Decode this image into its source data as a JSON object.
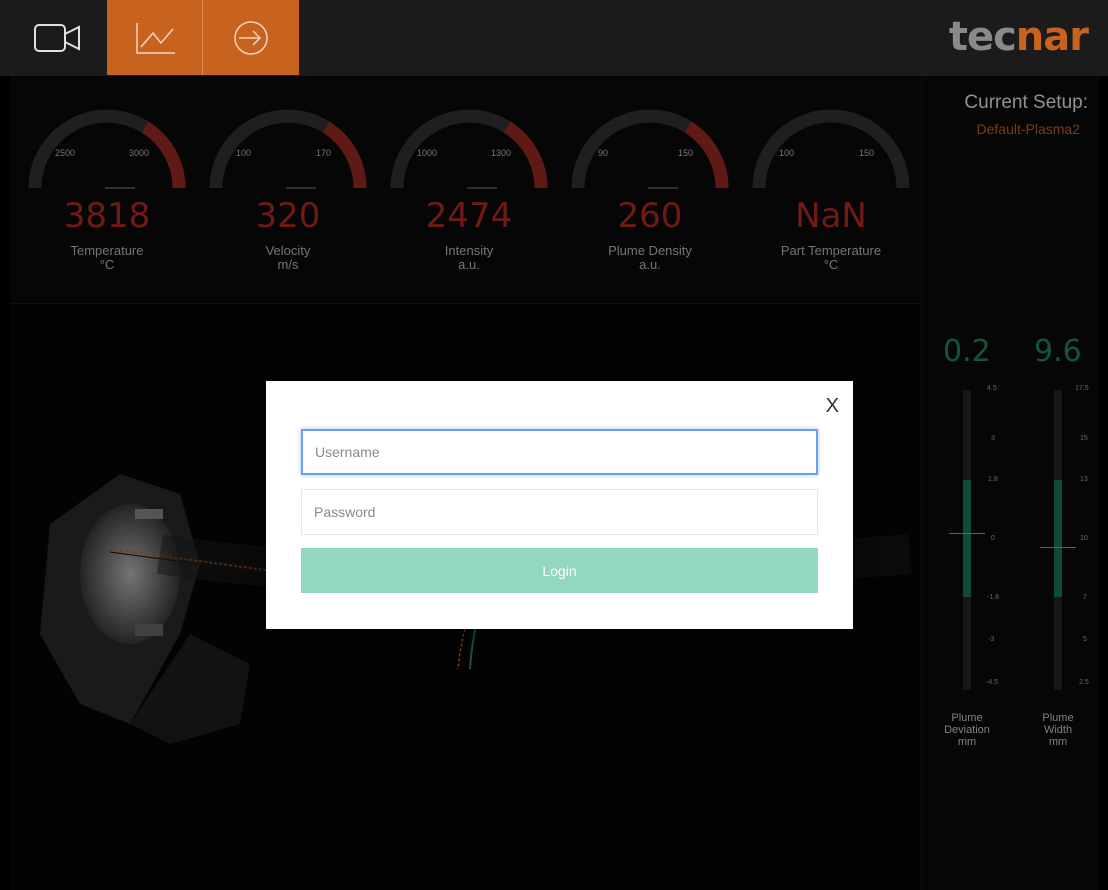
{
  "toolbar": {
    "buttons": [
      {
        "name": "camera",
        "icon": "video-camera-icon"
      },
      {
        "name": "chart",
        "icon": "line-chart-icon"
      },
      {
        "name": "login",
        "icon": "sign-in-icon"
      }
    ],
    "accent_color": "#c8621f"
  },
  "logo": {
    "part1": "tec",
    "part2": "nar",
    "color1": "#8a8a8a",
    "color2": "#c8621f"
  },
  "setup": {
    "title": "Current Setup:",
    "name": "Default-Plasma2"
  },
  "gauges": [
    {
      "low": "2500",
      "high": "3000",
      "value": "3818",
      "label": "Temperature",
      "unit": "°C"
    },
    {
      "low": "100",
      "high": "170",
      "value": "320",
      "label": "Velocity",
      "unit": "m/s"
    },
    {
      "low": "1000",
      "high": "1300",
      "value": "2474",
      "label": "Intensity",
      "unit": "a.u."
    },
    {
      "low": "90",
      "high": "150",
      "value": "260",
      "label": "Plume Density",
      "unit": "a.u."
    },
    {
      "low": "100",
      "high": "150",
      "value": "NaN",
      "label": "Part Temperature",
      "unit": "°C"
    }
  ],
  "bars": [
    {
      "value": "0.2",
      "label1": "Plume",
      "label2": "Deviation",
      "unit": "mm",
      "ticks": [
        "4.5",
        "3",
        "1.8",
        "0",
        "-1.8",
        "-3",
        "-4.5"
      ]
    },
    {
      "value": "9.6",
      "label1": "Plume",
      "label2": "Width",
      "unit": "mm",
      "ticks": [
        "17.5",
        "15",
        "13",
        "10",
        "7",
        "5",
        "2.5"
      ]
    }
  ],
  "modal": {
    "close_label": "X",
    "username_placeholder": "Username",
    "password_placeholder": "Password",
    "login_label": "Login"
  }
}
